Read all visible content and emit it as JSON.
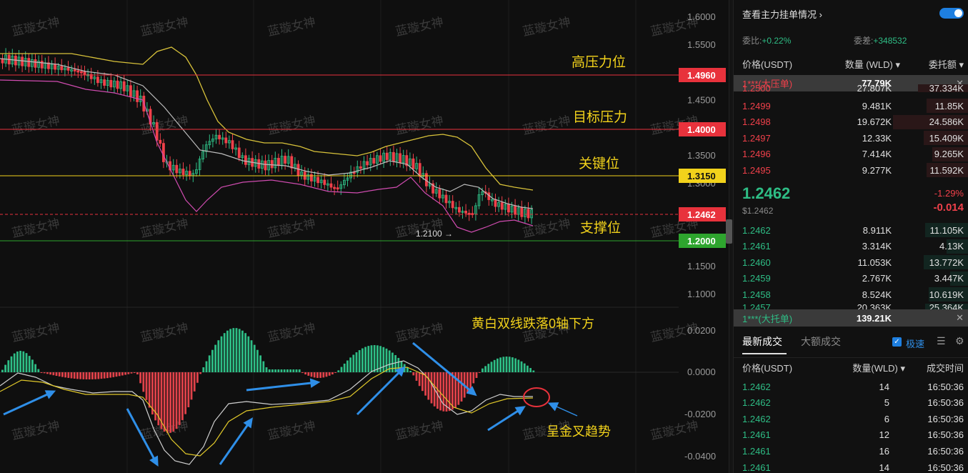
{
  "chart": {
    "watermark": "蓝璇女神",
    "price_axis": [
      "1.6000",
      "1.5500",
      "1.5000",
      "1.4500",
      "1.4000",
      "1.3500",
      "1.3000",
      "1.2500",
      "1.2000",
      "1.1500",
      "1.1000"
    ],
    "macd_axis": [
      "0.0200",
      "0.0000",
      "-0.0200",
      "-0.0400"
    ],
    "levels": [
      {
        "label": "高压力位",
        "price": "1.4960",
        "color": "#e8323c"
      },
      {
        "label": "目标压力",
        "price": "1.4000",
        "color": "#e8323c"
      },
      {
        "label": "关键位",
        "price": "1.3150",
        "color": "#f2d21b"
      },
      {
        "label": "支撑位",
        "price": "1.2000",
        "color": "#2ea52e"
      }
    ],
    "current_price_tag": "1.2462",
    "low_marker": "1.2100 →",
    "macd_annotation": "黄白双线跌落0轴下方",
    "cross_annotation": "呈金叉趋势"
  },
  "panel": {
    "title": "查看主力挂单情况",
    "weibi_label": "委比:",
    "weibi_value": "+0.22%",
    "weicha_label": "委差:",
    "weicha_value": "+348532",
    "col_price": "价格(USDT)",
    "col_qty": "数量 (WLD)",
    "col_amount": "委托额",
    "big_sell_label": "1***(大压单)",
    "big_sell_qty": "77.79K",
    "asks": [
      {
        "price": "1.2500",
        "qty": "27.807K",
        "amt": "37.334K"
      },
      {
        "price": "1.2499",
        "qty": "9.481K",
        "amt": "11.85K"
      },
      {
        "price": "1.2498",
        "qty": "19.672K",
        "amt": "24.586K"
      },
      {
        "price": "1.2497",
        "qty": "12.33K",
        "amt": "15.409K"
      },
      {
        "price": "1.2496",
        "qty": "7.414K",
        "amt": "9.265K"
      },
      {
        "price": "1.2495",
        "qty": "9.277K",
        "amt": "11.592K"
      }
    ],
    "last_price": "1.2462",
    "last_price_usd": "$1.2462",
    "change_pct": "-1.29%",
    "change_abs": "-0.014",
    "bids": [
      {
        "price": "1.2462",
        "qty": "8.911K",
        "amt": "11.105K"
      },
      {
        "price": "1.2461",
        "qty": "3.314K",
        "amt": "4.13K"
      },
      {
        "price": "1.2460",
        "qty": "11.053K",
        "amt": "13.772K"
      },
      {
        "price": "1.2459",
        "qty": "2.767K",
        "amt": "3.447K"
      },
      {
        "price": "1.2458",
        "qty": "8.524K",
        "amt": "10.619K"
      },
      {
        "price": "1.2457",
        "qty": "20.363K",
        "amt": "25.364K"
      }
    ],
    "big_buy_label": "1***(大托单)",
    "big_buy_qty": "139.21K",
    "tab_latest": "最新成交",
    "tab_large": "大额成交",
    "fast_label": "极速",
    "trade_col_price": "价格(USDT)",
    "trade_col_qty": "数量(WLD)",
    "trade_col_time": "成交时间",
    "trades": [
      {
        "price": "1.2462",
        "qty": "14",
        "time": "16:50:36"
      },
      {
        "price": "1.2462",
        "qty": "5",
        "time": "16:50:36"
      },
      {
        "price": "1.2462",
        "qty": "6",
        "time": "16:50:36"
      },
      {
        "price": "1.2461",
        "qty": "12",
        "time": "16:50:36"
      },
      {
        "price": "1.2461",
        "qty": "16",
        "time": "16:50:36"
      },
      {
        "price": "1.2461",
        "qty": "14",
        "time": "16:50:36"
      }
    ]
  }
}
